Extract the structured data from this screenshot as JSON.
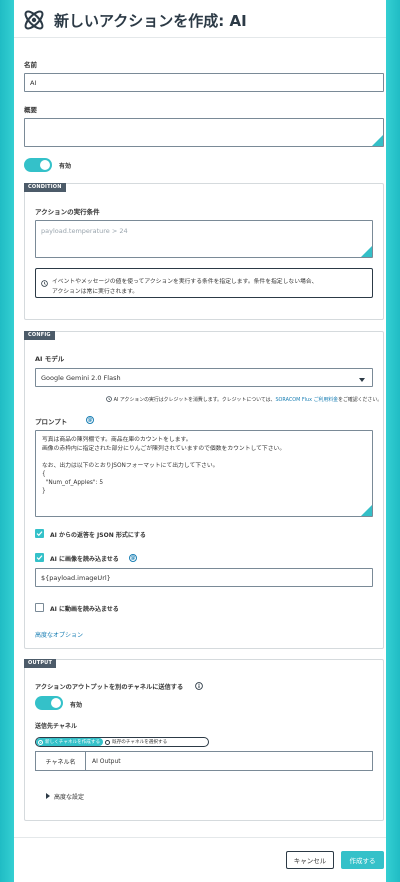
{
  "header": {
    "title": "新しいアクションを作成: AI",
    "logo_icon": "atom-logo-icon"
  },
  "name": {
    "label": "名前",
    "value": "AI"
  },
  "summary": {
    "label": "概要",
    "value": ""
  },
  "enabled": {
    "label": "有効",
    "on": true
  },
  "condition": {
    "tag": "CONDITION",
    "label": "アクションの実行条件",
    "placeholder": "payload.temperature > 24",
    "info": "イベントやメッセージの値を使ってアクションを実行する条件を指定します。条件を指定しない場合、",
    "info2": "アクションは常に実行されます。"
  },
  "config": {
    "tag": "CONFIG",
    "model_label": "AI モデル",
    "model_value": "Google Gemini 2.0 Flash",
    "note_pre": "AI アクションの実行はクレジットを消費します。クレジットについては、",
    "note_link": "SORACOM Flux ご利用料金",
    "note_post": "をご確認ください。",
    "prompt_label": "プロンプト",
    "prompt_lines": [
      "写真は商品の陳列棚です。商品在庫のカウントをします。",
      "画像の赤枠内に指定された部分にりんごが陳列されていますので個数をカウントして下さい。",
      "",
      "なお、出力は以下のとおりJSONフォーマットにて出力して下さい。",
      "{",
      "  \"Num_of_Apples\": 5",
      "}"
    ],
    "json_checkbox_label": "AI からの返答を JSON 形式にする",
    "json_checked": true,
    "image_checkbox_label": "AI に画像を読み込ませる",
    "image_checked": true,
    "image_url_value": "${payload.imageUrl}",
    "video_checkbox_label": "AI に動画を読み込ませる",
    "video_checked": false,
    "advanced_link": "高度なオプション"
  },
  "output": {
    "tag": "OUTPUT",
    "send_label": "アクションのアウトプットを別のチャネルに送信する",
    "send_toggle_label": "有効",
    "send_on": true,
    "dest_label": "送信先チャネル",
    "radio_new": "新しくチャネルを作成する",
    "radio_existing": "既存のチャネルを選択する",
    "channel_name_label": "チャネル名",
    "channel_name_value": "AI Output",
    "advanced_settings": "高度な設定"
  },
  "footer": {
    "cancel": "キャンセル",
    "create": "作成する"
  },
  "colors": {
    "accent": "#34c1c9",
    "dark": "#2c3a46",
    "link": "#1a7fb4"
  }
}
